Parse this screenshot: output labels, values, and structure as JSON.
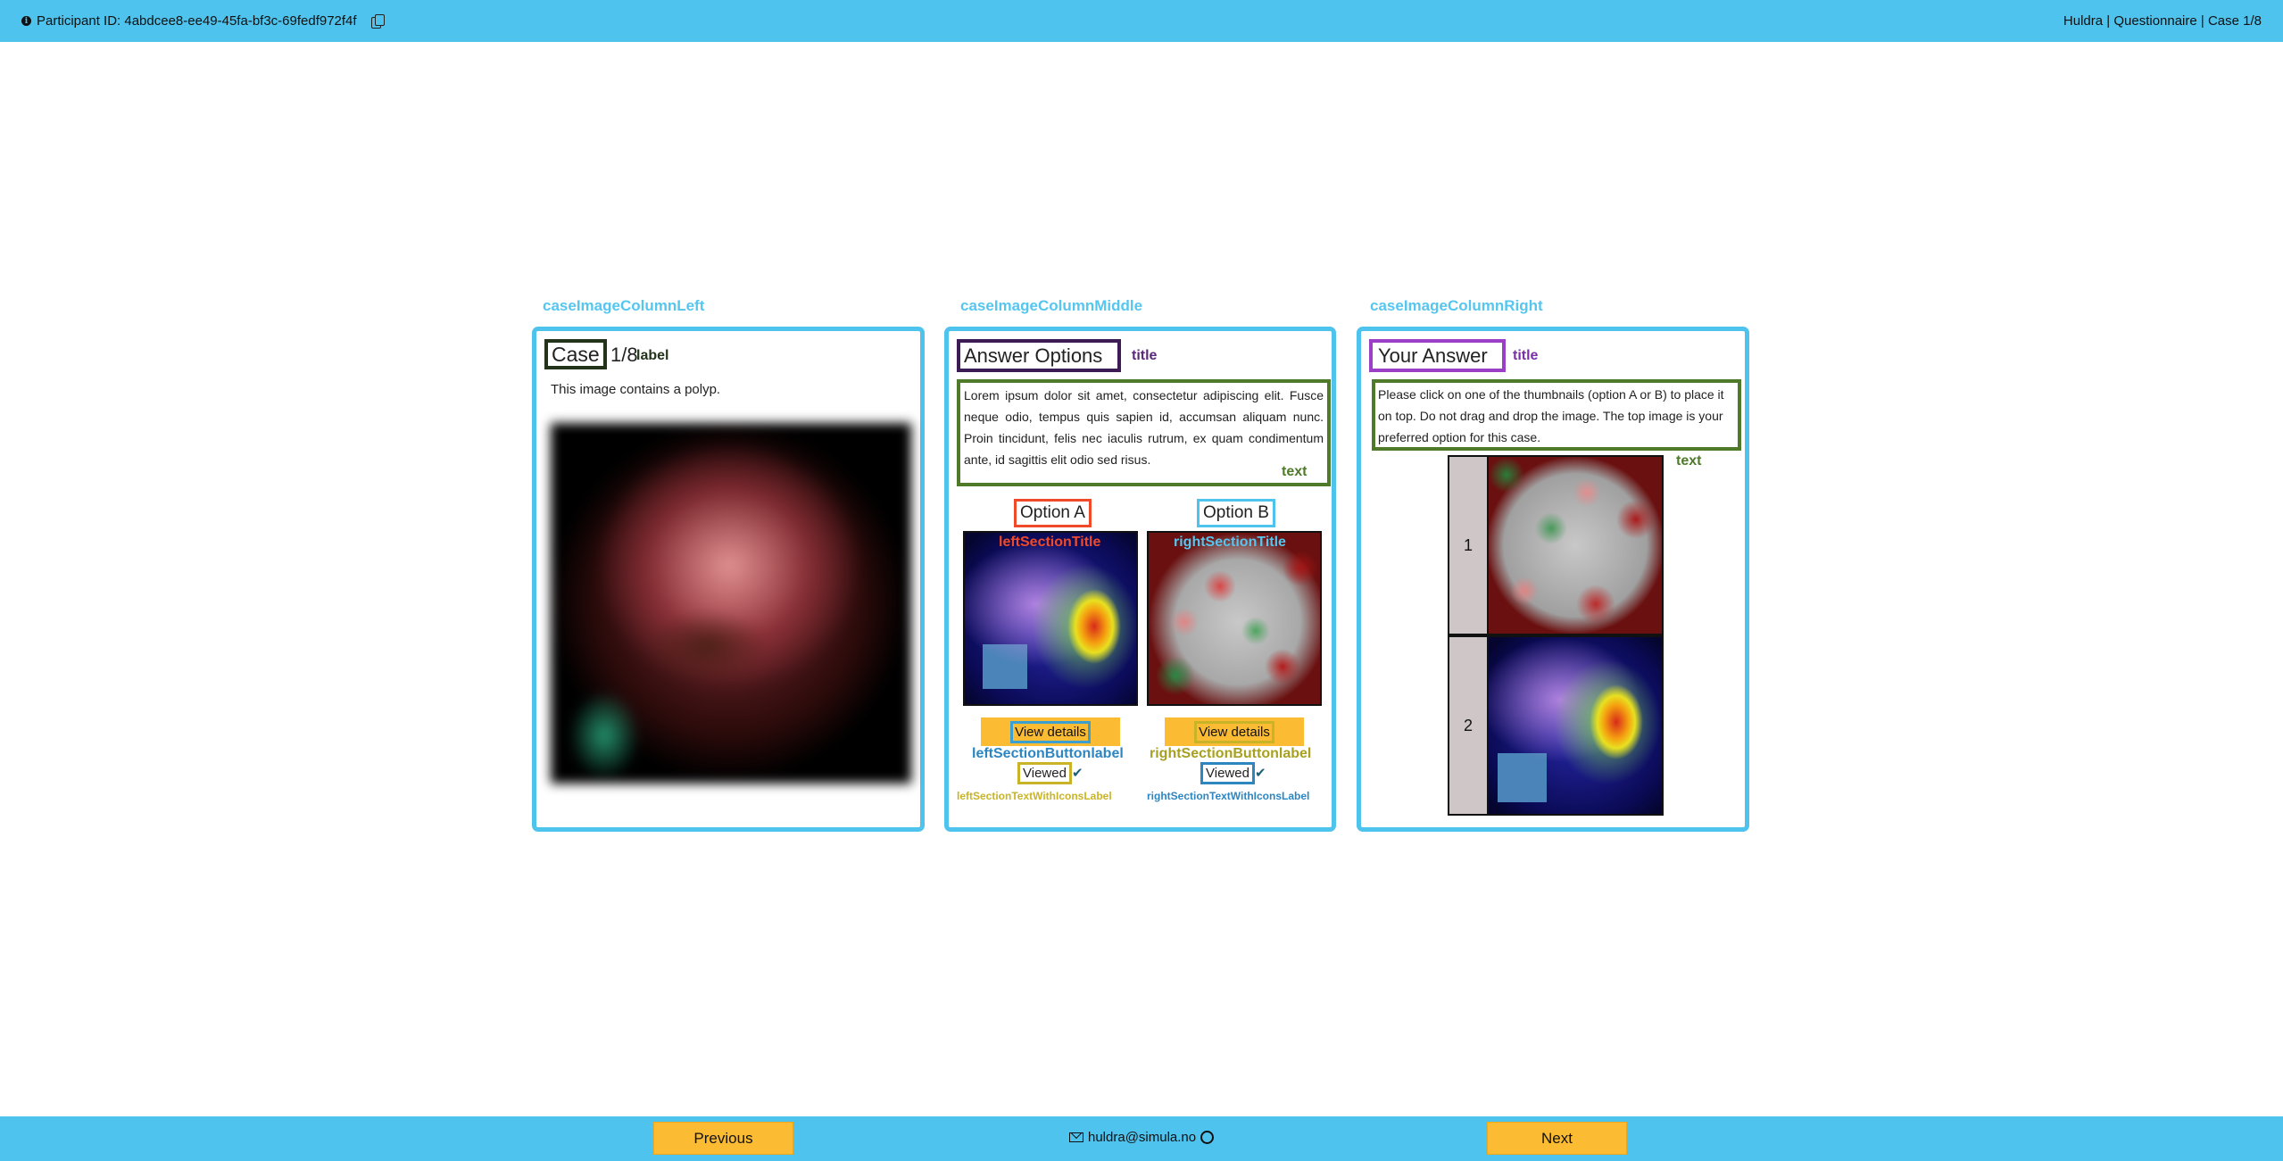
{
  "header": {
    "participant_label": "Participant ID: 4abdcee8-ee49-45fa-bf3c-69fedf972f4f",
    "breadcrumb": "Huldra | Questionnaire | Case 1/8"
  },
  "columns": {
    "left_label": "caseImageColumnLeft",
    "middle_label": "caseImageColumnMiddle",
    "right_label": "caseImageColumnRight"
  },
  "left_panel": {
    "case_word": "Case",
    "case_count": "1/8",
    "case_annotation": "label",
    "description": "This image contains a polyp."
  },
  "middle_panel": {
    "title": "Answer Options",
    "title_annotation": "title",
    "text": "Lorem ipsum dolor sit amet, consectetur adipiscing elit. Fusce neque odio, tempus quis sapien id, accumsan aliquam nunc. Proin tincidunt, felis nec iaculis rutrum, ex quam condimentum ante, id sagittis elit odio sed risus.",
    "text_annotation": "text",
    "option_a": {
      "label": "Option A",
      "section_title": "leftSectionTitle",
      "button": "View details",
      "button_annotation": "leftSectionButtonlabel",
      "status": "Viewed",
      "status_annotation": "leftSectionTextWithIconsLabel"
    },
    "option_b": {
      "label": "Option B",
      "section_title": "rightSectionTitle",
      "button": "View details",
      "button_annotation": "rightSectionButtonlabel",
      "status": "Viewed",
      "status_annotation": "rightSectionTextWithIconsLabel"
    }
  },
  "right_panel": {
    "title": "Your Answer",
    "title_annotation": "title",
    "text": "Please click on one of the thumbnails (option A or B) to place it on top. Do not drag and drop the image. The top image is your preferred option for this case.",
    "text_annotation": "text",
    "ranks": [
      "1",
      "2"
    ]
  },
  "footer": {
    "previous": "Previous",
    "email": "huldra@simula.no",
    "next": "Next"
  },
  "colors": {
    "bar": "#4ec3ee",
    "button": "#fbbc34",
    "annotation_green": "#4e7a2a",
    "annotation_purple": "#7b2fa6",
    "option_a": "#ef4b2a",
    "option_b": "#4ec3ee"
  }
}
